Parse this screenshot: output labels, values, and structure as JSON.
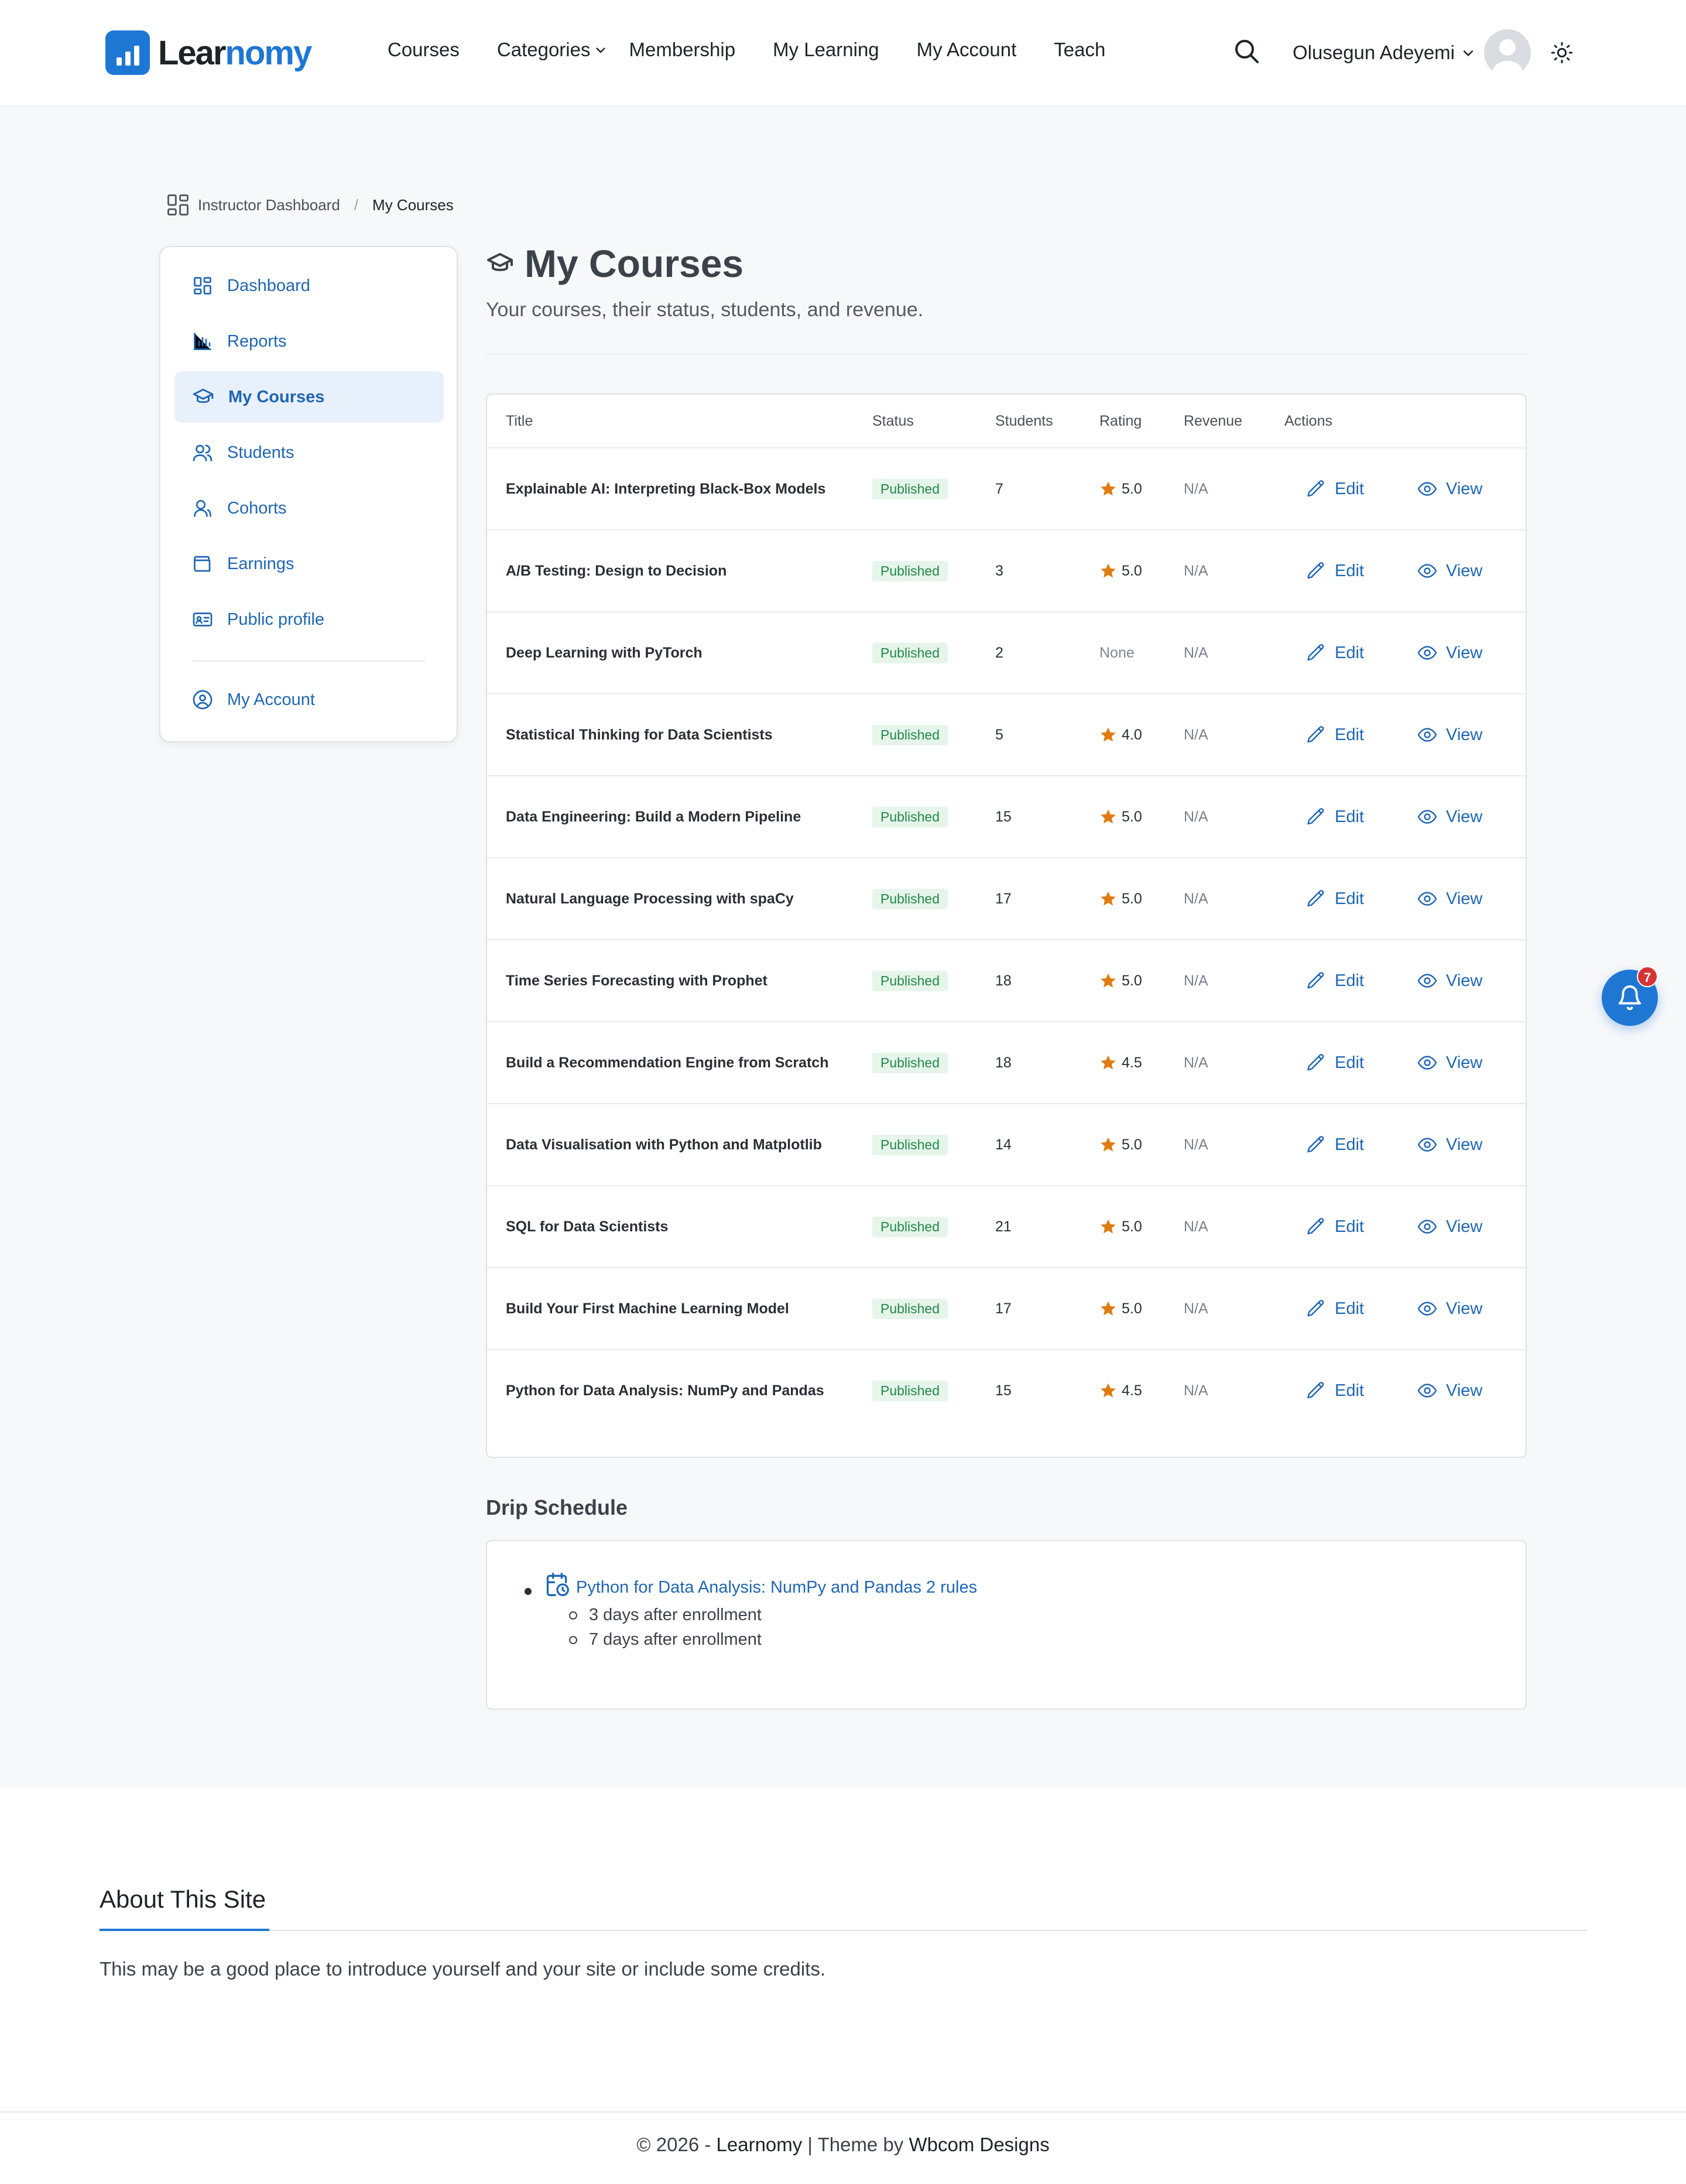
{
  "brand": {
    "name_part1": "Lear",
    "name_part2": "nomy",
    "accent": "#1f77d4"
  },
  "nav": {
    "items": [
      "Courses",
      "Categories",
      "Membership",
      "My Learning",
      "My Account",
      "Teach"
    ],
    "user_name": "Olusegun Adeyemi"
  },
  "breadcrumb": {
    "parent": "Instructor Dashboard",
    "separator": "/",
    "current": "My Courses"
  },
  "sidebar": {
    "items": [
      {
        "label": "Dashboard",
        "icon": "dashboard-icon"
      },
      {
        "label": "Reports",
        "icon": "bar-chart-icon"
      },
      {
        "label": "My Courses",
        "icon": "graduation-cap-icon",
        "active": true
      },
      {
        "label": "Students",
        "icon": "users-icon"
      },
      {
        "label": "Cohorts",
        "icon": "user-group-icon"
      },
      {
        "label": "Earnings",
        "icon": "wallet-icon"
      },
      {
        "label": "Public profile",
        "icon": "id-card-icon"
      },
      {
        "label": "My Account",
        "icon": "user-circle-icon"
      }
    ]
  },
  "page": {
    "title": "My Courses",
    "subtitle": "Your courses, their status, students, and revenue."
  },
  "table": {
    "headers": [
      "Title",
      "Status",
      "Students",
      "Rating",
      "Revenue",
      "Actions"
    ],
    "edit_label": "Edit",
    "view_label": "View",
    "rows": [
      {
        "title": "Explainable AI: Interpreting Black-Box Models",
        "status": "Published",
        "students": "7",
        "rating": "5.0",
        "revenue": "N/A"
      },
      {
        "title": "A/B Testing: Design to Decision",
        "status": "Published",
        "students": "3",
        "rating": "5.0",
        "revenue": "N/A"
      },
      {
        "title": "Deep Learning with PyTorch",
        "status": "Published",
        "students": "2",
        "rating": "None",
        "revenue": "N/A"
      },
      {
        "title": "Statistical Thinking for Data Scientists",
        "status": "Published",
        "students": "5",
        "rating": "4.0",
        "revenue": "N/A"
      },
      {
        "title": "Data Engineering: Build a Modern Pipeline",
        "status": "Published",
        "students": "15",
        "rating": "5.0",
        "revenue": "N/A"
      },
      {
        "title": "Natural Language Processing with spaCy",
        "status": "Published",
        "students": "17",
        "rating": "5.0",
        "revenue": "N/A"
      },
      {
        "title": "Time Series Forecasting with Prophet",
        "status": "Published",
        "students": "18",
        "rating": "5.0",
        "revenue": "N/A"
      },
      {
        "title": "Build a Recommendation Engine from Scratch",
        "status": "Published",
        "students": "18",
        "rating": "4.5",
        "revenue": "N/A"
      },
      {
        "title": "Data Visualisation with Python and Matplotlib",
        "status": "Published",
        "students": "14",
        "rating": "5.0",
        "revenue": "N/A"
      },
      {
        "title": "SQL for Data Scientists",
        "status": "Published",
        "students": "21",
        "rating": "5.0",
        "revenue": "N/A"
      },
      {
        "title": "Build Your First Machine Learning Model",
        "status": "Published",
        "students": "17",
        "rating": "5.0",
        "revenue": "N/A"
      },
      {
        "title": "Python for Data Analysis: NumPy and Pandas",
        "status": "Published",
        "students": "15",
        "rating": "4.5",
        "revenue": "N/A"
      }
    ]
  },
  "drip": {
    "heading": "Drip Schedule",
    "course_link": "Python for Data Analysis: NumPy and Pandas 2 rules",
    "rules": [
      "3 days after enrollment",
      "7 days after enrollment"
    ]
  },
  "notifications": {
    "count": "7"
  },
  "footer": {
    "about_heading": "About This Site",
    "about_text": "This may be a good place to introduce yourself and your site or include some credits.",
    "copyright_prefix": "© 2026 - ",
    "site": "Learnomy",
    "theme_by": " | Theme by ",
    "designer": "Wbcom Designs"
  }
}
